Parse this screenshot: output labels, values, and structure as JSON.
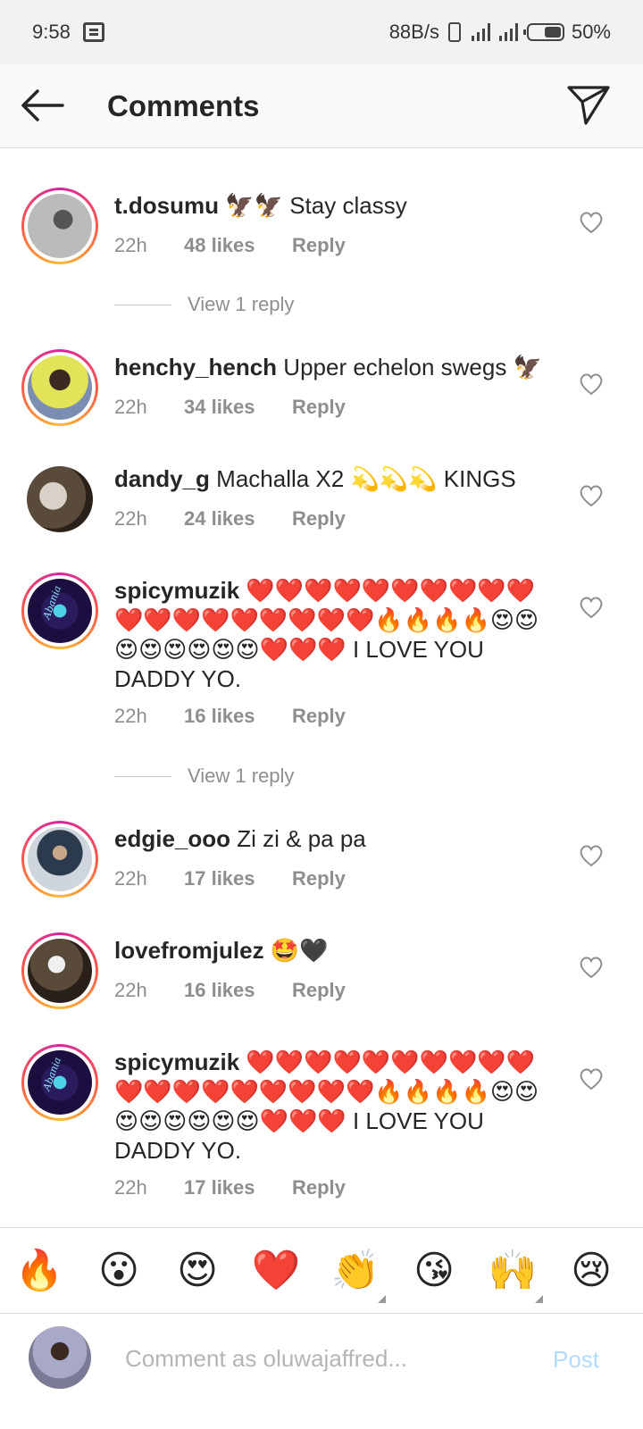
{
  "status_bar": {
    "time": "9:58",
    "speed": "88B/s",
    "battery": "50%"
  },
  "header": {
    "title": "Comments"
  },
  "comments": [
    {
      "user": "t.dosumu",
      "body": "🦅🦅 Stay classy",
      "time": "22h",
      "likes": "48 likes",
      "reply": "Reply"
    },
    {
      "user": "henchy_hench",
      "body": "Upper echelon swegs 🦅",
      "time": "22h",
      "likes": "34 likes",
      "reply": "Reply"
    },
    {
      "user": "dandy_g",
      "body": "Machalla X2 💫💫💫 KINGS",
      "time": "22h",
      "likes": "24 likes",
      "reply": "Reply"
    },
    {
      "user": "spicymuzik",
      "body": "❤️❤️❤️❤️❤️❤️❤️❤️❤️❤️❤️❤️❤️❤️❤️❤️❤️❤️❤️🔥🔥🔥🔥😍😍😍😍😍😍😍😍❤️❤️❤️ I LOVE YOU DADDY YO.",
      "time": "22h",
      "likes": "16 likes",
      "reply": "Reply"
    },
    {
      "user": "edgie_ooo",
      "body": "Zi zi & pa pa",
      "time": "22h",
      "likes": "17 likes",
      "reply": "Reply"
    },
    {
      "user": "lovefromjulez",
      "body": "🤩🖤",
      "time": "22h",
      "likes": "16 likes",
      "reply": "Reply"
    },
    {
      "user": "spicymuzik",
      "body": "❤️❤️❤️❤️❤️❤️❤️❤️❤️❤️❤️❤️❤️❤️❤️❤️❤️❤️❤️🔥🔥🔥🔥😍😍😍😍😍😍😍😍❤️❤️❤️ I LOVE YOU DADDY YO.",
      "time": "22h",
      "likes": "17 likes",
      "reply": "Reply"
    }
  ],
  "view_replies": [
    "View 1 reply",
    "View 1 reply"
  ],
  "avatar_brand": "Abania",
  "quick_emojis": [
    "🔥",
    "😮",
    "😍",
    "❤️",
    "👏",
    "😘",
    "🙌",
    "😢"
  ],
  "composer": {
    "placeholder": "Comment as oluwajaffred...",
    "post_label": "Post"
  },
  "colors": {
    "post": "#b3dbff",
    "meta": "#8e8e8e",
    "text": "#262626"
  }
}
